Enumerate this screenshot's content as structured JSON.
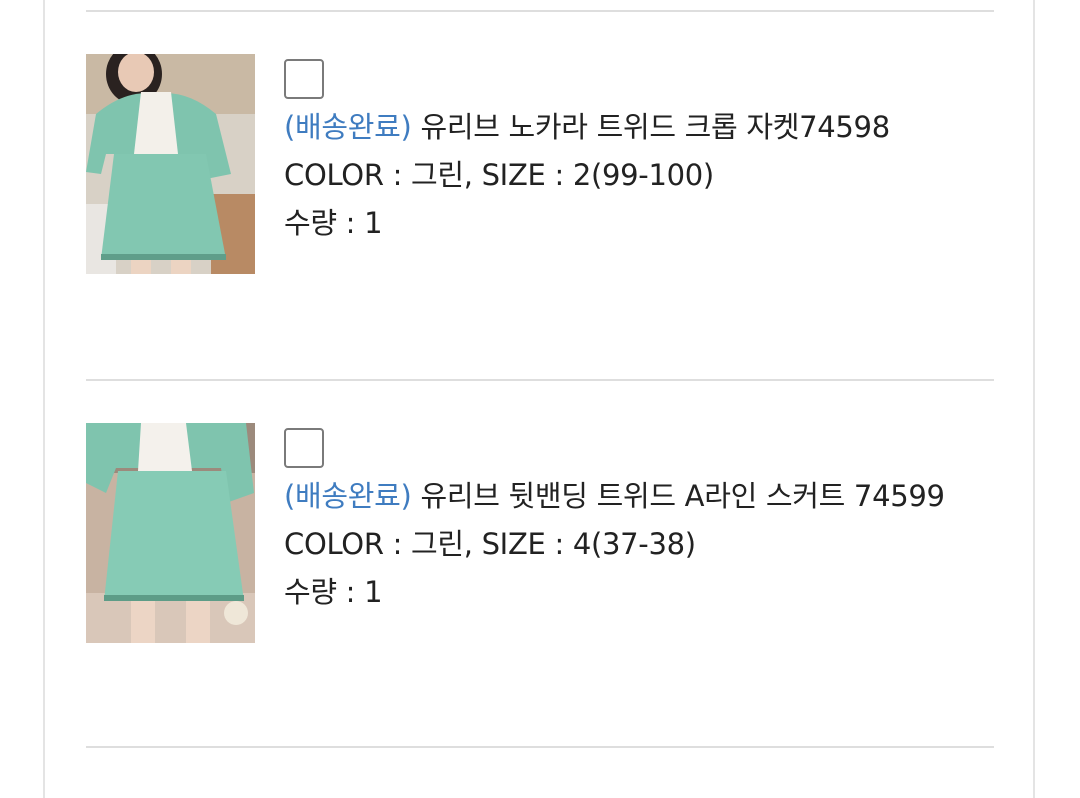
{
  "orders": [
    {
      "status": "(배송완료)",
      "name": " 유리브 노카라 트위드 크롭 자켓74598",
      "option": "COLOR : 그린, SIZE : 2(99-100)",
      "quantity": "수량 : 1",
      "thumb_colors": {
        "outfit": "#7fc4ae",
        "background": "#cfc7bb"
      }
    },
    {
      "status": "(배송완료)",
      "name": " 유리브 뒷밴딩 트위드 A라인 스커트 74599",
      "option": "COLOR : 그린, SIZE : 4(37-38)",
      "quantity": "수량 : 1",
      "thumb_colors": {
        "outfit": "#86cbb5",
        "background": "#bfa99a"
      }
    }
  ],
  "colors": {
    "status_link": "#3f7cc0",
    "text": "#222222",
    "divider": "#dedede"
  }
}
